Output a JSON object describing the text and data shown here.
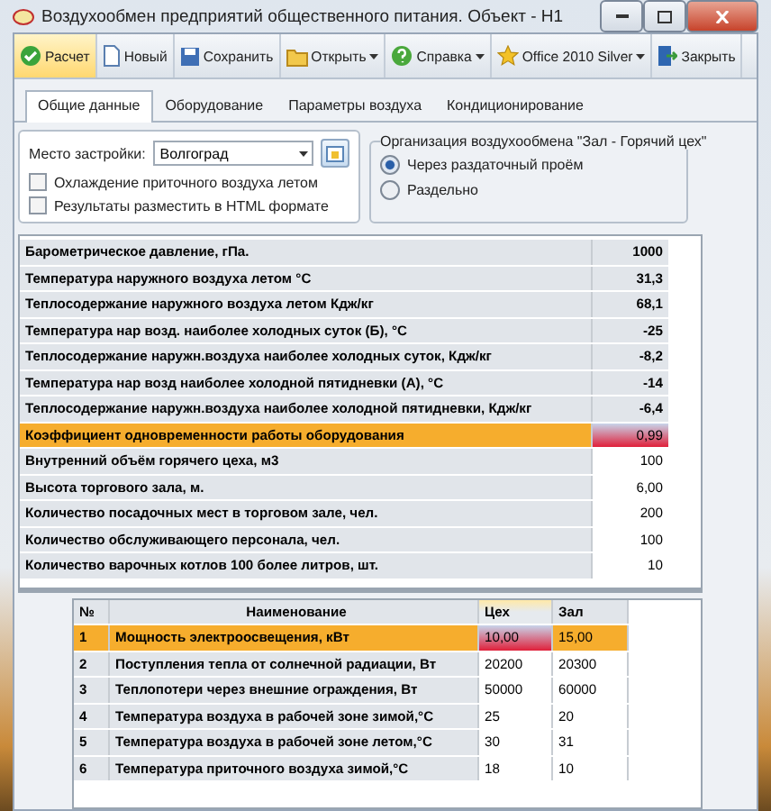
{
  "window": {
    "title": "Воздухообмен предприятий общественного питания. Объект - Н1"
  },
  "toolbar": [
    {
      "label": "Расчет",
      "selected": true,
      "dropdown": false
    },
    {
      "label": "Новый",
      "selected": false,
      "dropdown": false
    },
    {
      "label": "Сохранить",
      "selected": false,
      "dropdown": false
    },
    {
      "label": "Открыть",
      "selected": false,
      "dropdown": true
    },
    {
      "label": "Справка",
      "selected": false,
      "dropdown": true
    },
    {
      "label": "Office 2010 Silver",
      "selected": false,
      "dropdown": true
    },
    {
      "label": "Закрыть",
      "selected": false,
      "dropdown": false
    }
  ],
  "tabs": [
    {
      "label": "Общие данные",
      "selected": true
    },
    {
      "label": "Оборудование",
      "selected": false
    },
    {
      "label": "Параметры воздуха",
      "selected": false
    },
    {
      "label": "Кондиционирование",
      "selected": false
    }
  ],
  "location": {
    "label": "Место застройки:",
    "value": "Волгоград"
  },
  "options": [
    {
      "label": "Охлаждение приточного воздуха летом",
      "checked": false
    },
    {
      "label": "Результаты разместить в HTML формате",
      "checked": false
    }
  ],
  "air_exchange": {
    "title": "Организация воздухообмена \"Зал - Горячий цех\"",
    "choices": [
      {
        "label": "Через раздаточный проём",
        "selected": true
      },
      {
        "label": "Раздельно",
        "selected": false
      }
    ]
  },
  "parameters": [
    {
      "name": "Барометрическое давление, гПа.",
      "value": "1000",
      "editable": false,
      "selected": false
    },
    {
      "name": "Температура наружного  воздуха летом °С",
      "value": "31,3",
      "editable": false,
      "selected": false
    },
    {
      "name": "Теплосодержание наружного  воздуха летом Кдж/кг",
      "value": "68,1",
      "editable": false,
      "selected": false
    },
    {
      "name": "Температура нар возд. наиболее холодных суток (Б), °С",
      "value": "-25",
      "editable": false,
      "selected": false
    },
    {
      "name": "Теплосодержание наружн.воздуха наиболее холодных суток, Кдж/кг",
      "value": "-8,2",
      "editable": false,
      "selected": false
    },
    {
      "name": "Температура нар возд наиболее холодной пятидневки (А), °С",
      "value": "-14",
      "editable": false,
      "selected": false
    },
    {
      "name": "Теплосодержание наружн.воздуха наиболее холодной пятидневки, Кдж/кг",
      "value": "-6,4",
      "editable": false,
      "selected": false
    },
    {
      "name": "Коэффициент одновременности работы оборудования",
      "value": "0,99",
      "editable": true,
      "selected": true
    },
    {
      "name": "Внутренний объём горячего цеха, м3",
      "value": "100",
      "editable": true,
      "selected": false
    },
    {
      "name": "Высота торгового зала, м.",
      "value": "6,00",
      "editable": true,
      "selected": false
    },
    {
      "name": "Количество посадочных мест в торговом зале, чел.",
      "value": "200",
      "editable": true,
      "selected": false
    },
    {
      "name": "Количество обслуживающего персонала, чел.",
      "value": "100",
      "editable": true,
      "selected": false
    },
    {
      "name": "Количество варочных котлов 100 более литров, шт.",
      "value": "10",
      "editable": true,
      "selected": false
    }
  ],
  "loads": {
    "columns": [
      {
        "label": "№",
        "selected": false
      },
      {
        "label": "Наименование",
        "selected": false
      },
      {
        "label": "Цех",
        "selected": true
      },
      {
        "label": "Зал",
        "selected": false
      }
    ],
    "rows": [
      {
        "cells": [
          "1",
          "Мощность электроосвещения,            кВт",
          "10,00",
          "15,00"
        ],
        "selected": true
      },
      {
        "cells": [
          "2",
          "Поступления тепла от солнечной радиации, Вт",
          "20200",
          "20300"
        ],
        "selected": false
      },
      {
        "cells": [
          "3",
          "Теплопотери через внешние ограждения,    Вт",
          "50000",
          "60000"
        ],
        "selected": false
      },
      {
        "cells": [
          "4",
          "Температура воздуха в рабочей зоне зимой,°С",
          "25",
          "20"
        ],
        "selected": false
      },
      {
        "cells": [
          "5",
          "Температура воздуха в рабочей зоне летом,°С",
          "30",
          "31"
        ],
        "selected": false
      },
      {
        "cells": [
          "6",
          "Температура приточного воздуха     зимой,°С",
          "18",
          "10"
        ],
        "selected": false
      }
    ]
  }
}
